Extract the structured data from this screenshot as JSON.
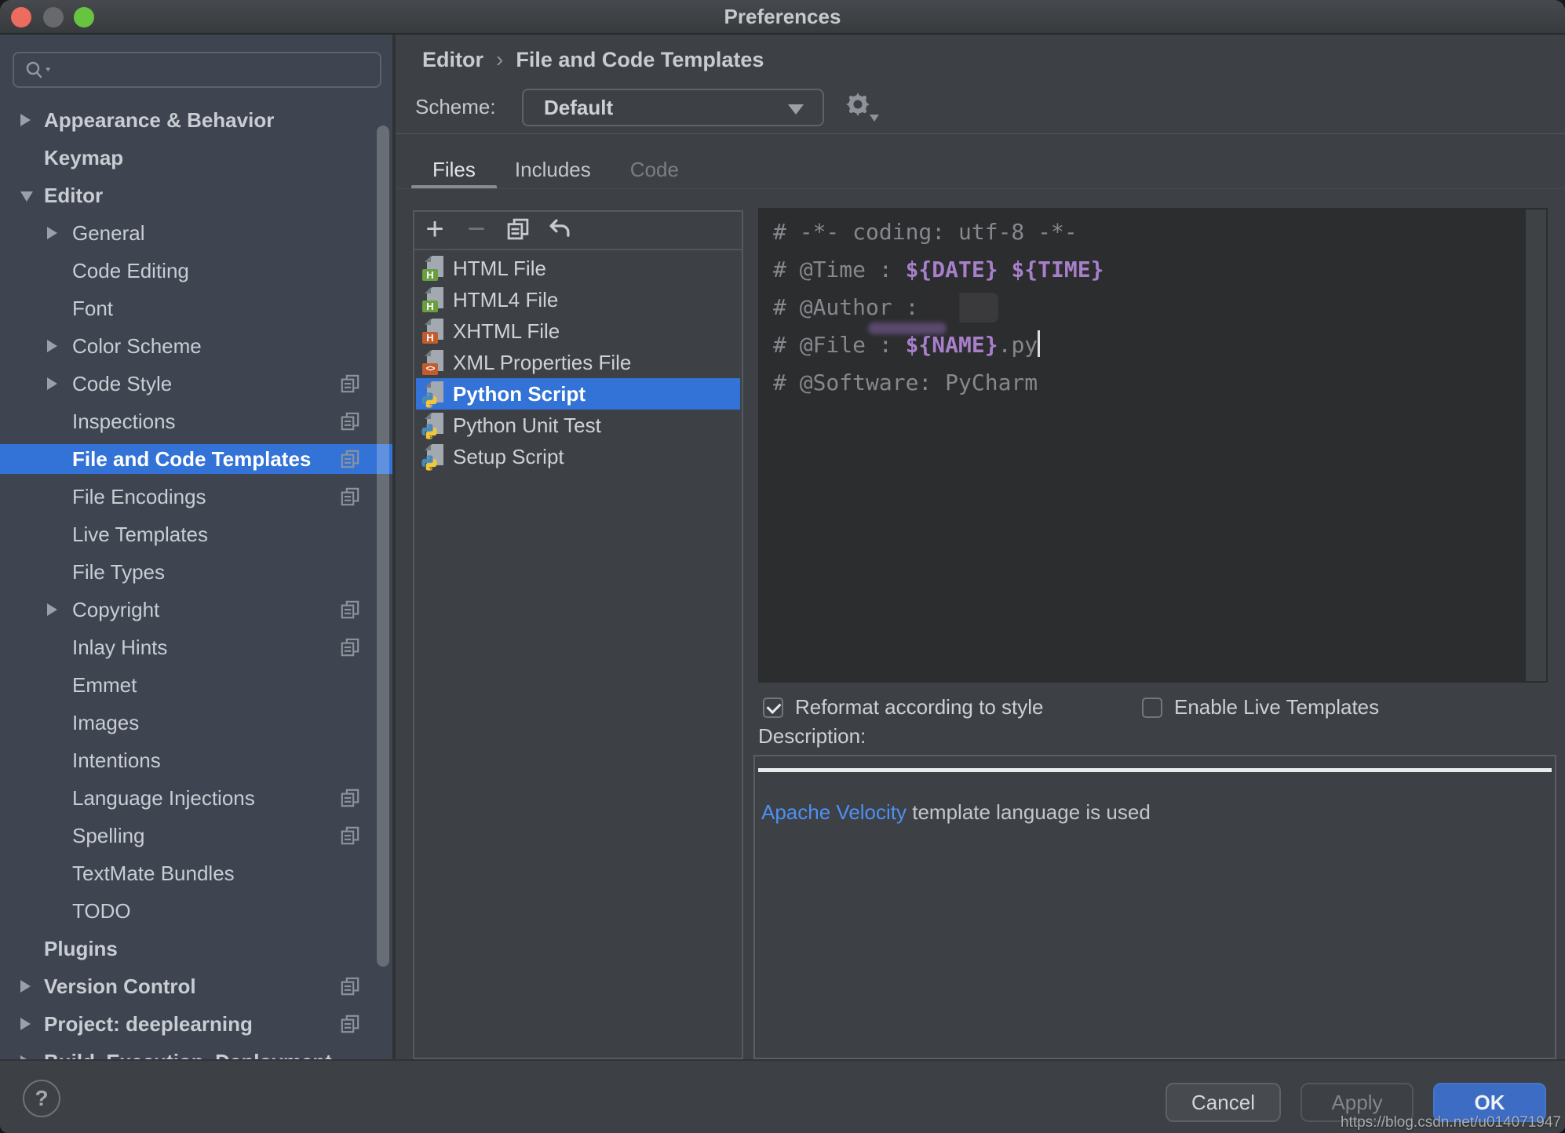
{
  "window": {
    "title": "Preferences"
  },
  "colors": {
    "selection_blue": "#3372d6",
    "link_blue": "#4f8ff2",
    "ok_button_blue": "#3d6cc4",
    "template_var_purple": "#a87fc9",
    "traffic_red": "#ee6b5f",
    "traffic_gray": "#67696d",
    "traffic_green": "#68c440",
    "editor_bg": "#2b2d2f",
    "sidebar_bg": "#3e4450"
  },
  "sidebar": {
    "search_placeholder": "",
    "items": [
      {
        "label": "Appearance & Behavior",
        "level": 1,
        "arrow": "right",
        "bold": true
      },
      {
        "label": "Keymap",
        "level": 1,
        "bold": true
      },
      {
        "label": "Editor",
        "level": 1,
        "arrow": "down",
        "bold": true
      },
      {
        "label": "General",
        "level": 2,
        "arrow": "right"
      },
      {
        "label": "Code Editing",
        "level": 2
      },
      {
        "label": "Font",
        "level": 2
      },
      {
        "label": "Color Scheme",
        "level": 2,
        "arrow": "right"
      },
      {
        "label": "Code Style",
        "level": 2,
        "arrow": "right",
        "copy": true
      },
      {
        "label": "Inspections",
        "level": 2,
        "copy": true
      },
      {
        "label": "File and Code Templates",
        "level": 2,
        "copy": true,
        "selected": true
      },
      {
        "label": "File Encodings",
        "level": 2,
        "copy": true
      },
      {
        "label": "Live Templates",
        "level": 2
      },
      {
        "label": "File Types",
        "level": 2
      },
      {
        "label": "Copyright",
        "level": 2,
        "arrow": "right",
        "copy": true
      },
      {
        "label": "Inlay Hints",
        "level": 2,
        "copy": true
      },
      {
        "label": "Emmet",
        "level": 2
      },
      {
        "label": "Images",
        "level": 2
      },
      {
        "label": "Intentions",
        "level": 2
      },
      {
        "label": "Language Injections",
        "level": 2,
        "copy": true
      },
      {
        "label": "Spelling",
        "level": 2,
        "copy": true
      },
      {
        "label": "TextMate Bundles",
        "level": 2
      },
      {
        "label": "TODO",
        "level": 2
      },
      {
        "label": "Plugins",
        "level": 1,
        "bold": true
      },
      {
        "label": "Version Control",
        "level": 1,
        "arrow": "right",
        "bold": true,
        "copy": true
      },
      {
        "label": "Project: deeplearning",
        "level": 1,
        "arrow": "right",
        "bold": true,
        "copy": true
      },
      {
        "label": "Build, Execution, Deployment",
        "level": 1,
        "arrow": "right",
        "bold": true
      }
    ]
  },
  "breadcrumb": {
    "items": [
      "Editor",
      "File and Code Templates"
    ],
    "separator": "›"
  },
  "scheme": {
    "label": "Scheme:",
    "value": "Default"
  },
  "tabs": [
    {
      "label": "Files",
      "state": "active"
    },
    {
      "label": "Includes",
      "state": "normal"
    },
    {
      "label": "Code",
      "state": "disabled"
    }
  ],
  "toolbar": {
    "add": "+",
    "remove": "−",
    "copy_icon": "copy-template",
    "revert_icon": "revert-changes"
  },
  "templates": [
    {
      "name": "HTML File",
      "icon": "html"
    },
    {
      "name": "HTML4 File",
      "icon": "html"
    },
    {
      "name": "XHTML File",
      "icon": "xhtml"
    },
    {
      "name": "XML Properties File",
      "icon": "xmlprops"
    },
    {
      "name": "Python Script",
      "icon": "python",
      "selected": true
    },
    {
      "name": "Python Unit Test",
      "icon": "python"
    },
    {
      "name": "Setup Script",
      "icon": "python"
    }
  ],
  "editor": {
    "lines": [
      [
        {
          "t": "# -*- coding: utf-8 -*-",
          "s": "c"
        }
      ],
      [
        {
          "t": "# @Time : ",
          "s": "c"
        },
        {
          "t": "${DATE}",
          "s": "v"
        },
        {
          "t": " ",
          "s": "c"
        },
        {
          "t": "${TIME}",
          "s": "v"
        }
      ],
      [
        {
          "t": "# @Author : ",
          "s": "c"
        },
        {
          "s": "redact"
        }
      ],
      [
        {
          "t": "# @File : ",
          "s": "c"
        },
        {
          "t": "${NAME}",
          "s": "v",
          "smear": true
        },
        {
          "t": ".py",
          "s": "c"
        },
        {
          "s": "caret"
        }
      ],
      [
        {
          "t": "# @Software: PyCharm",
          "s": "c"
        }
      ]
    ]
  },
  "options": {
    "reformat": {
      "label": "Reformat according to style",
      "checked": true
    },
    "live_templates": {
      "label": "Enable Live Templates",
      "checked": false
    }
  },
  "description": {
    "label": "Description:",
    "link_text": "Apache Velocity",
    "text": " template language is used"
  },
  "footer": {
    "help": "?",
    "cancel": "Cancel",
    "apply": "Apply",
    "ok": "OK",
    "watermark": "https://blog.csdn.net/u014071947"
  }
}
